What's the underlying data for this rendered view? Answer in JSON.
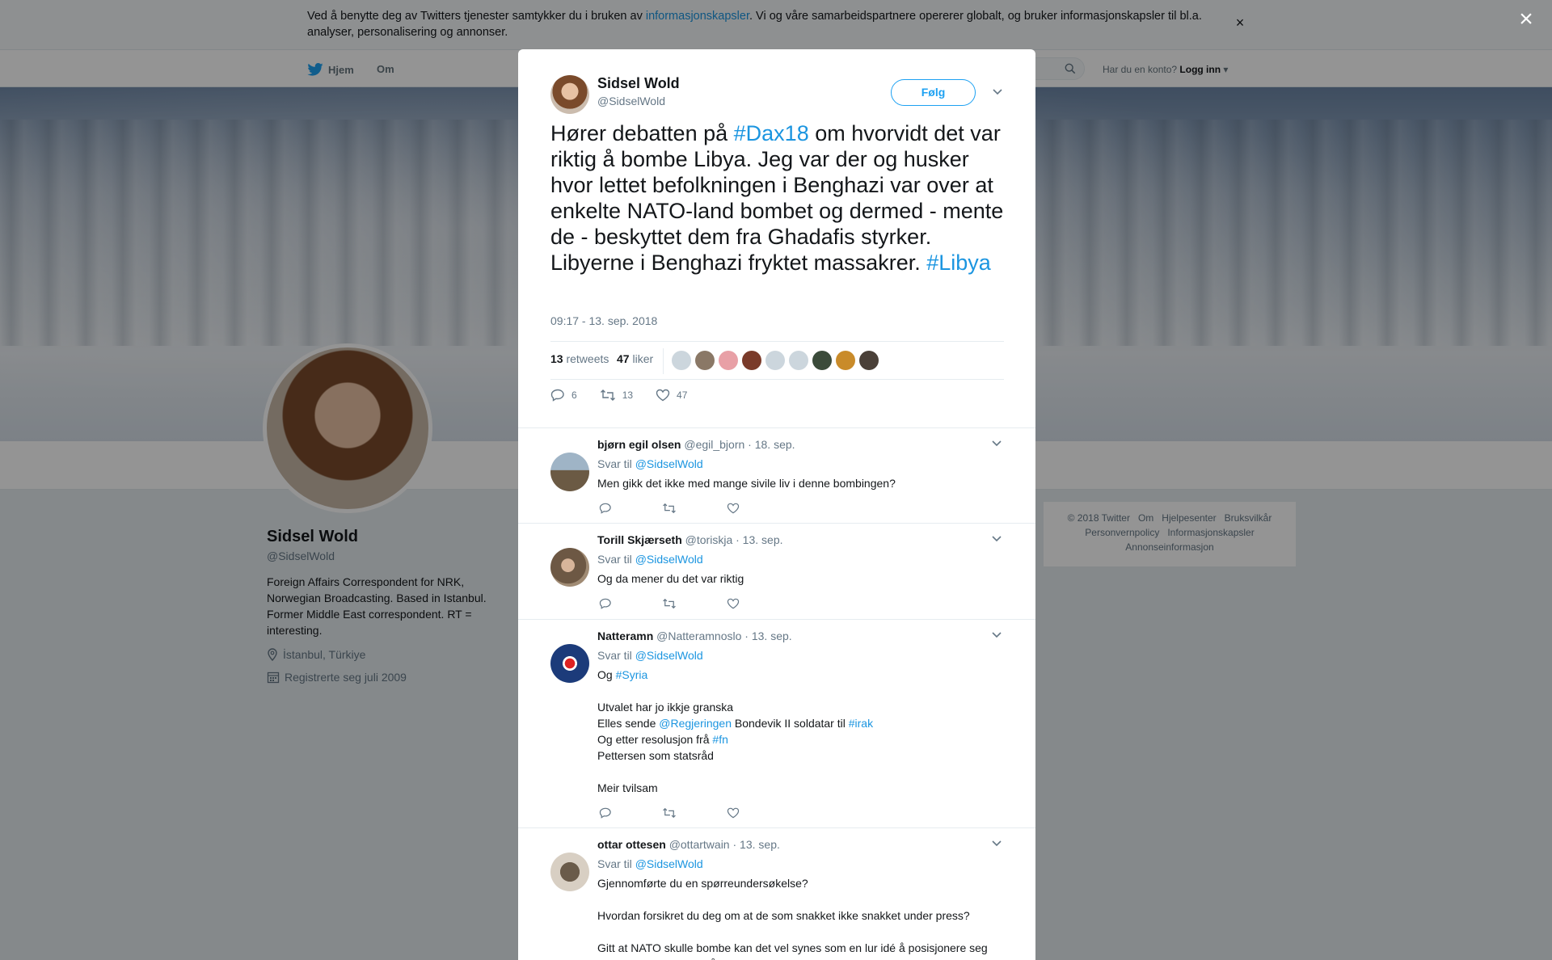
{
  "cookie": {
    "text_before": "Ved å benytte deg av Twitters tjenester samtykker du i bruken av ",
    "link": "informasjonskapsler",
    "text_after": ". Vi og våre samarbeidspartnere opererer globalt, og bruker informasjonskapsler til bl.a. analyser, personalisering og annonser.",
    "close": "×"
  },
  "nav": {
    "home": "Hjem",
    "about": "Om",
    "account_prompt": "Har du en konto?",
    "login": "Logg inn"
  },
  "profile": {
    "name": "Sidsel Wold",
    "handle": "@SidselWold",
    "bio": "Foreign Affairs Correspondent for NRK, Norwegian Broadcasting. Based in Istanbul. Former Middle East correspondent. RT = interesting.",
    "location": "İstanbul, Türkiye",
    "joined": "Registrerte seg juli 2009"
  },
  "footer": {
    "links": [
      "© 2018 Twitter",
      "Om",
      "Hjelpesenter",
      "Bruksvilkår",
      "Personvernpolicy",
      "Informasjonskapsler",
      "Annonseinformasjon"
    ]
  },
  "overlay": {
    "close": "×"
  },
  "tweet": {
    "author_name": "Sidsel Wold",
    "author_handle": "@SidselWold",
    "follow_label": "Følg",
    "text_1": "Hører debatten på ",
    "hashtag_1": "#Dax18",
    "text_2": " om hvorvidt det var riktig å bombe Libya.  Jeg var der og husker hvor lettet befolkningen i Benghazi var over at enkelte NATO-land bombet og dermed - mente de - beskyttet dem fra Ghadafis styrker. Libyerne i Benghazi fryktet massakrer. ",
    "hashtag_2": "#Libya",
    "timestamp": "09:17 - 13. sep. 2018",
    "retweets_count": "13",
    "retweets_label": "retweets",
    "likes_count": "47",
    "likes_label": "liker",
    "reply_count": "6",
    "retweet_action_count": "13",
    "like_action_count": "47"
  },
  "replies": [
    {
      "name": "bjørn egil olsen",
      "handle": "@egil_bjorn",
      "date": "· 18. sep.",
      "reply_prefix": "Svar til",
      "reply_to": "@SidselWold",
      "body": "Men gikk det ikke med mange sivile liv i denne bombingen?"
    },
    {
      "name": "Torill Skjærseth",
      "handle": "@toriskja",
      "date": "· 13. sep.",
      "reply_prefix": "Svar til",
      "reply_to": "@SidselWold",
      "body": "Og da mener du det var riktig"
    },
    {
      "name": "Natteramn",
      "handle": "@Natteramnoslo",
      "date": "· 13. sep.",
      "reply_prefix": "Svar til",
      "reply_to": "@SidselWold",
      "body_og": "Og ",
      "tag_syria": "#Syria",
      "line_utvalet": "Utvalet har jo ikkje granska",
      "line_elles_1": "Elles sende ",
      "mention_regjeringen": "@Regjeringen",
      "line_elles_2": " Bondevik II soldatar til ",
      "tag_irak": "#irak",
      "line_resolusjon": "Og etter resolusjon frå ",
      "tag_fn": "#fn",
      "line_pettersen": "Pettersen som statsråd",
      "line_meir": "Meir tvilsam"
    },
    {
      "name": "ottar ottesen",
      "handle": "@ottartwain",
      "date": "· 13. sep.",
      "reply_prefix": "Svar til",
      "reply_to": "@SidselWold",
      "line_1": "Gjennomførte du en spørreundersøkelse?",
      "line_2": "Hvordan forsikret du deg om at de som snakket ikke snakket under press?",
      "line_3": "Gitt at NATO skulle bombe kan det vel synes som en lur idé å posisjonere seg velvillig ovenfor dem? Å si noe annet ville vel betydd den sikre død, mener jeg?"
    }
  ],
  "colors": {
    "link": "#1b95e0",
    "accent": "#1da1f2",
    "muted": "#657786"
  }
}
